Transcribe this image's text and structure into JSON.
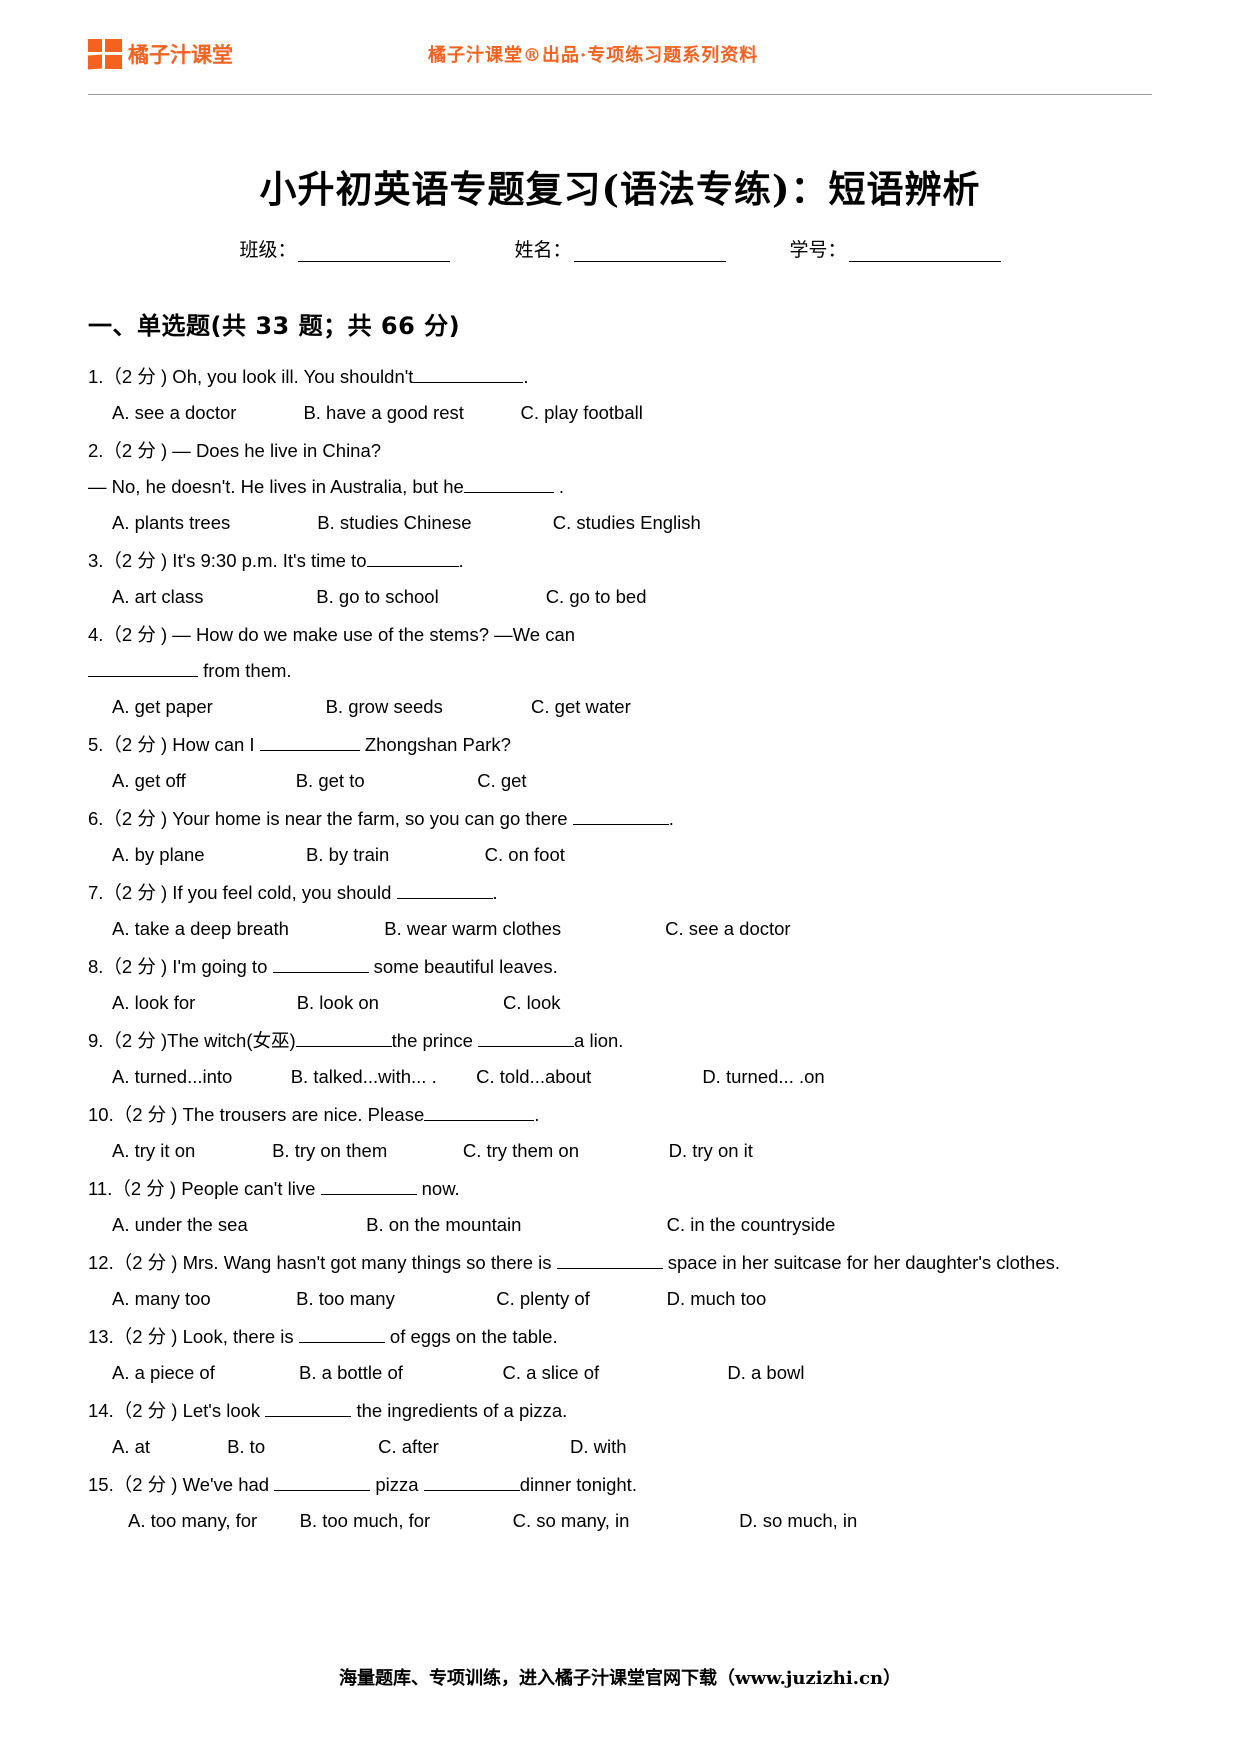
{
  "header": {
    "brand_name": "橘子汁课堂",
    "tagline": "橘子汁课堂®出品·专项练习题系列资料",
    "logo_icon": "orange-four-square-logo"
  },
  "title": "小升初英语专题复习(语法专练)：短语辨析",
  "id_fields": [
    {
      "label": "班级："
    },
    {
      "label": "姓名："
    },
    {
      "label": "学号："
    }
  ],
  "section": {
    "heading": "一、单选题(共 33 题；共 66 分)"
  },
  "questions": [
    {
      "stem": "1.（2 分 ) Oh, you look ill. You shouldn't",
      "blank_after_stem": 110,
      "stem_tail": ".",
      "options": [
        "A. see a doctor",
        "B. have a good rest",
        "C. play football"
      ],
      "option_offsets": [
        0,
        196,
        416
      ]
    },
    {
      "stem": "2.（2 分 ) — Does he live in China?",
      "continuation": "— No, he doesn't. He lives in Australia, but he",
      "cont_blank": 90,
      "cont_tail": " .",
      "options": [
        "A. plants trees",
        "B. studies Chinese",
        "C. studies English"
      ],
      "option_offsets": [
        0,
        216,
        452
      ]
    },
    {
      "stem": "3.（2 分 ) It's 9:30 p.m. It's time to",
      "blank_after_stem": 92,
      "stem_tail": ".",
      "options": [
        "A. art class",
        "B. go to school",
        "C. go to bed"
      ],
      "option_offsets": [
        0,
        216,
        452
      ]
    },
    {
      "stem": "4.（2 分 ) — How do we make use of the stems? —We can",
      "continuation_blank_first": 110,
      "continuation": " from them.",
      "options": [
        "A. get paper",
        "B. grow seeds",
        "C. get water"
      ],
      "option_offsets": [
        0,
        216,
        416
      ]
    },
    {
      "stem_pre": "5.（2 分 ) How can I ",
      "blank_mid": 100,
      "stem_post": " Zhongshan Park?",
      "options": [
        "A. get off",
        "B. get to",
        "C. get"
      ],
      "option_offsets": [
        0,
        196,
        386
      ]
    },
    {
      "stem": "6.（2 分 ) Your home is near the farm, so you can go there ",
      "blank_after_stem": 96,
      "stem_tail": ".",
      "options": [
        "A. by plane",
        "B. by train",
        "C. on foot"
      ],
      "option_offsets": [
        0,
        196,
        386
      ]
    },
    {
      "stem": "7.（2 分 ) If you feel cold, you should ",
      "blank_after_stem": 96,
      "stem_tail": ".",
      "options": [
        "A. take a deep breath",
        "B. wear warm clothes",
        "C. see a doctor"
      ],
      "option_offsets": [
        0,
        276,
        552
      ]
    },
    {
      "stem_pre": "8.（2 分 ) I'm going to ",
      "blank_mid": 96,
      "stem_post": " some beautiful leaves.",
      "options": [
        "A. look for",
        "B. look on",
        "C. look"
      ],
      "option_offsets": [
        0,
        196,
        406
      ]
    },
    {
      "stem_pre": "9.（2 分 )The witch(女巫)",
      "blank_mid": 96,
      "stem_mid2": "the prince ",
      "blank_mid3": 96,
      "stem_post": "a lion.",
      "options": [
        "A. turned...into",
        "B. talked...with... .",
        "C. told...about",
        "D. turned... .on"
      ],
      "option_offsets": [
        0,
        196,
        416,
        656
      ]
    },
    {
      "stem": "10.（2 分 ) The trousers are nice. Please",
      "blank_after_stem": 110,
      "stem_tail": ".",
      "options": [
        "A. try it on",
        "B. try on them",
        "C. try them on",
        "D. try on it"
      ],
      "option_offsets": [
        0,
        180,
        376,
        586
      ]
    },
    {
      "stem_pre": "11.（2 分 ) People can't live ",
      "blank_mid": 96,
      "stem_post": " now.",
      "options": [
        "A. under the sea",
        "B. on the mountain",
        "C. in the countryside"
      ],
      "option_offsets": [
        0,
        256,
        556
      ]
    },
    {
      "stem_pre": "12.（2 分 ) Mrs. Wang hasn't got many things so there is ",
      "blank_mid": 106,
      "stem_post": " space in her suitcase for her daughter's clothes.",
      "options": [
        "A. many too",
        "B. too many",
        "C. plenty of",
        "D. much too"
      ],
      "option_offsets": [
        0,
        180,
        376,
        556
      ]
    },
    {
      "stem_pre": "13.（2 分 ) Look, there is ",
      "blank_mid": 86,
      "stem_post": " of eggs on the table.",
      "options": [
        "A. a piece of",
        "B. a bottle of",
        "C. a slice of",
        "D. a bowl"
      ],
      "option_offsets": [
        0,
        196,
        416,
        656
      ]
    },
    {
      "stem_pre": "14.（2 分 ) Let's look ",
      "blank_mid": 86,
      "stem_post": " the ingredients of a pizza.",
      "options": [
        "A. at",
        "B. to",
        "C. after",
        "D. with"
      ],
      "option_offsets": [
        0,
        120,
        276,
        476
      ]
    },
    {
      "stem_pre": "15.（2 分 ) We've had ",
      "blank_mid": 96,
      "stem_mid2": " pizza ",
      "blank_mid3": 96,
      "stem_post": "dinner tonight.",
      "options": [
        "A. too many, for",
        "B. too much, for",
        "C. so many, in",
        "D. so much, in"
      ],
      "option_offsets": [
        16,
        196,
        416,
        646
      ]
    }
  ],
  "footer": {
    "text": "海量题库、专项训练，进入橘子汁课堂官网下载（www.juzizhi.cn）"
  },
  "colors": {
    "brand_orange": "#f4621f",
    "text": "#000000",
    "rule": "#9a9a9a",
    "page_bg": "#ffffff"
  }
}
